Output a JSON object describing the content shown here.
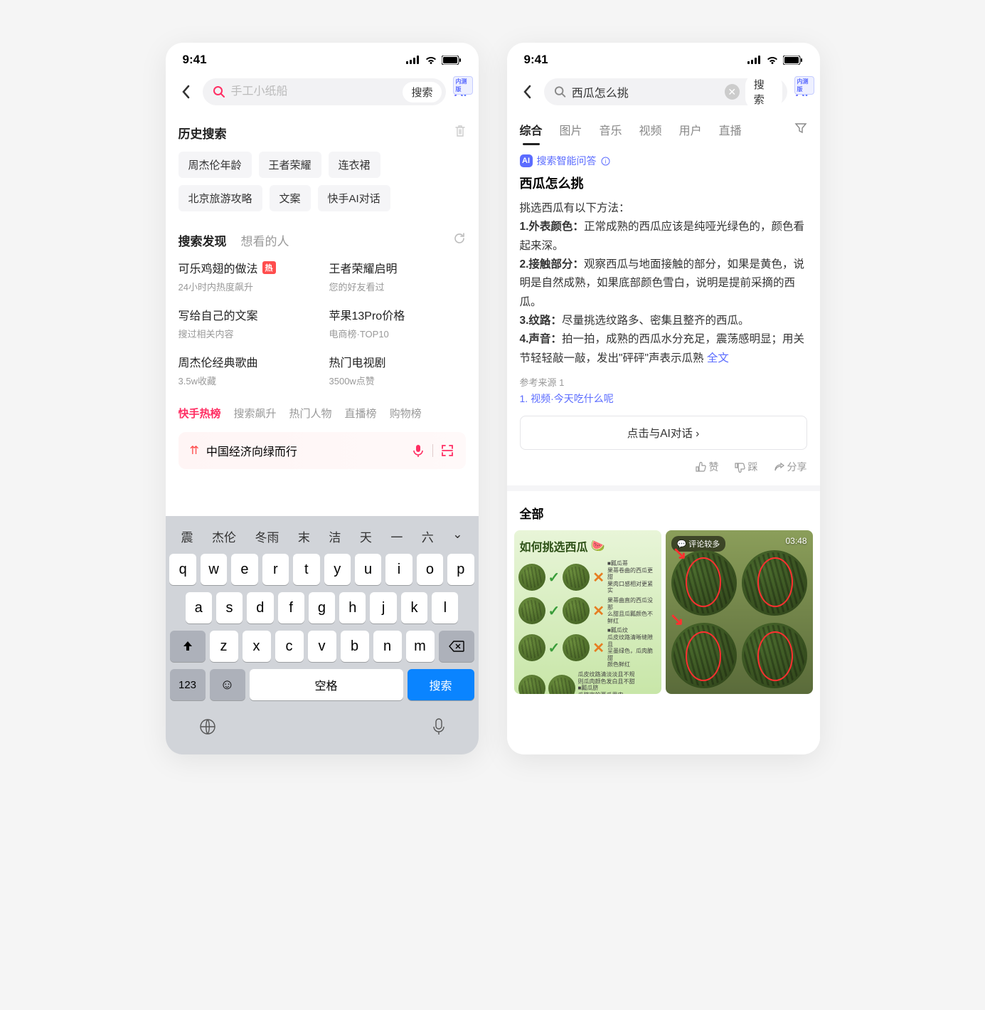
{
  "status": {
    "time": "9:41"
  },
  "left": {
    "search": {
      "placeholder": "手工小纸船",
      "button": "搜索",
      "ai": "Ai"
    },
    "history": {
      "title": "历史搜索",
      "items": [
        "周杰伦年龄",
        "王者荣耀",
        "连衣裙",
        "北京旅游攻略",
        "文案",
        "快手AI对话"
      ]
    },
    "discover": {
      "tab1": "搜索发现",
      "tab2": "想看的人",
      "items": [
        {
          "t": "可乐鸡翅的做法",
          "s": "24小时内热度飙升",
          "hot": true
        },
        {
          "t": "王者荣耀启明",
          "s": "您的好友看过"
        },
        {
          "t": "写给自己的文案",
          "s": "搜过相关内容"
        },
        {
          "t": "苹果13Pro价格",
          "s": "电商榜·TOP10"
        },
        {
          "t": "周杰伦经典歌曲",
          "s": "3.5w收藏"
        },
        {
          "t": "热门电视剧",
          "s": "3500w点赞"
        }
      ]
    },
    "ranks": [
      "快手热榜",
      "搜索飙升",
      "热门人物",
      "直播榜",
      "购物榜"
    ],
    "trend": "中国经济向绿而行",
    "keyboard": {
      "candidates": [
        "震",
        "杰伦",
        "冬雨",
        "末",
        "洁",
        "天",
        "一",
        "六"
      ],
      "r1": [
        "q",
        "w",
        "e",
        "r",
        "t",
        "y",
        "u",
        "i",
        "o",
        "p"
      ],
      "r2": [
        "a",
        "s",
        "d",
        "f",
        "g",
        "h",
        "j",
        "k",
        "l"
      ],
      "r3": [
        "z",
        "x",
        "c",
        "v",
        "b",
        "n",
        "m"
      ],
      "num": "123",
      "space": "空格",
      "enter": "搜索"
    }
  },
  "right": {
    "search": {
      "value": "西瓜怎么挑",
      "button": "搜索",
      "ai": "Ai"
    },
    "tabs": [
      "综合",
      "图片",
      "音乐",
      "视频",
      "用户",
      "直播"
    ],
    "ai": {
      "label": "搜索智能问答",
      "title": "西瓜怎么挑",
      "intro": "挑选西瓜有以下方法：",
      "p1": {
        "h": "1.外表颜色：",
        "b": "正常成熟的西瓜应该是纯哑光绿色的，颜色看起来深。"
      },
      "p2": {
        "h": "2.接触部分：",
        "b": "观察西瓜与地面接触的部分，如果是黄色，说明是自然成熟，如果底部颜色雪白，说明是提前采摘的西瓜。"
      },
      "p3": {
        "h": "3.纹路：",
        "b": "尽量挑选纹路多、密集且整齐的西瓜。"
      },
      "p4": {
        "h": "4.声音：",
        "b": "拍一拍，成熟的西瓜水分充足，震荡感明显；用关节轻轻敲一敲，发出\"砰砰\"声表示瓜熟"
      },
      "more": "全文",
      "src": "参考来源 1",
      "srclink": "1. 视频·今天吃什么呢",
      "chat": "点击与AI对话 ›",
      "like": "赞",
      "dislike": "踩",
      "share": "分享"
    },
    "all": "全部",
    "card1": {
      "title": "如何挑选西瓜",
      "badge_comment": "评论较多",
      "duration": "03:48"
    }
  }
}
